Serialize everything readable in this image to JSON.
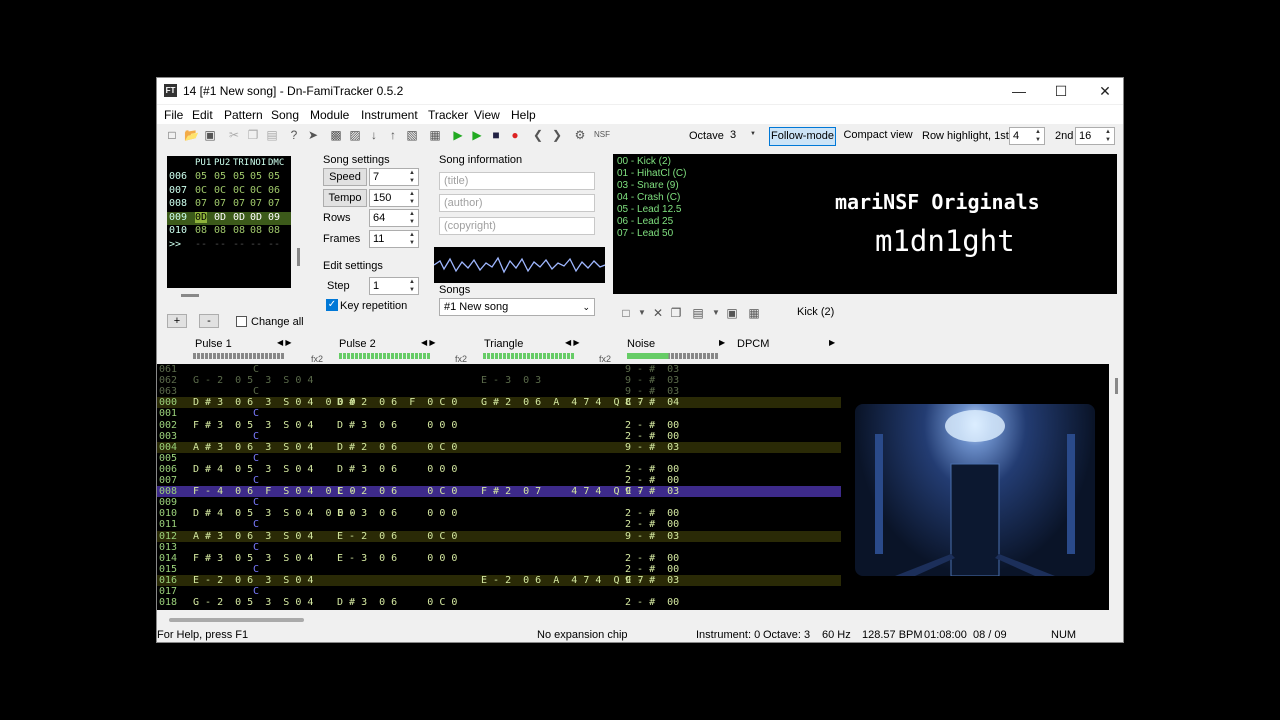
{
  "window": {
    "title": "14 [#1 New song] - Dn-FamiTracker 0.5.2"
  },
  "menu": [
    "File",
    "Edit",
    "Pattern",
    "Song",
    "Module",
    "Instrument",
    "Tracker",
    "View",
    "Help"
  ],
  "toolbar": {
    "octave_label": "Octave",
    "octave_value": "3",
    "follow_mode": "Follow-mode",
    "compact_view": "Compact view",
    "row_highlight_label": "Row highlight, 1st",
    "row_highlight_1st": "4",
    "second_label": "2nd",
    "row_highlight_2nd": "16",
    "nsf_icon": "NSF"
  },
  "frames": {
    "header": [
      "PU1",
      "PU2",
      "TRI",
      "NOI",
      "DMC"
    ],
    "rows": [
      {
        "num": "006",
        "vals": [
          "05",
          "05",
          "05",
          "05",
          "05"
        ]
      },
      {
        "num": "007",
        "vals": [
          "0C",
          "0C",
          "0C",
          "0C",
          "06"
        ]
      },
      {
        "num": "008",
        "vals": [
          "07",
          "07",
          "07",
          "07",
          "07"
        ]
      },
      {
        "num": "009",
        "vals": [
          "0D",
          "0D",
          "0D",
          "0D",
          "09"
        ]
      },
      {
        "num": "010",
        "vals": [
          "08",
          "08",
          "08",
          "08",
          "08"
        ]
      },
      {
        "num": ">>",
        "vals": [
          "--",
          "--",
          "--",
          "--",
          "--"
        ]
      }
    ],
    "add": "+",
    "remove": "-",
    "change_all": "Change all"
  },
  "song_settings": {
    "title": "Song settings",
    "speed_label": "Speed",
    "speed": "7",
    "tempo_label": "Tempo",
    "tempo": "150",
    "rows_label": "Rows",
    "rows": "64",
    "frames_label": "Frames",
    "frames": "11"
  },
  "edit_settings": {
    "title": "Edit settings",
    "step_label": "Step",
    "step": "1",
    "key_repetition": "Key repetition"
  },
  "song_info": {
    "title": "Song information",
    "title_ph": "(title)",
    "author_ph": "(author)",
    "copyright_ph": "(copyright)"
  },
  "songs": {
    "label": "Songs",
    "selected": "#1 New song"
  },
  "instruments": {
    "items": [
      "00 - Kick (2)",
      "01 - HihatCl (C)",
      "03 - Snare (9)",
      "04 - Crash (C)",
      "05 - Lead 12.5",
      "06 - Lead 25",
      "07 - Lead 50"
    ],
    "overlay_line1": "mariNSF Originals",
    "overlay_line2": "m1dn1ght",
    "selected_name": "Kick (2)"
  },
  "channels": {
    "pulse1": "Pulse 1",
    "pulse2": "Pulse 2",
    "triangle": "Triangle",
    "noise": "Noise",
    "dpcm": "DPCM",
    "fx": "fx2"
  },
  "pattern_rows": [
    {
      "n": "061",
      "p1": "",
      "c": "C",
      "p2": "",
      "tr": "",
      "no": "9 - #  03"
    },
    {
      "n": "062",
      "p1": "G - 2  0 5  3  S 0 4",
      "c": "",
      "p2": "",
      "tr": "E - 3  0 3",
      "no": "9 - #  03"
    },
    {
      "n": "063",
      "p1": "",
      "c": "C",
      "p2": "",
      "tr": "",
      "no": "9 - #  03"
    },
    {
      "n": "000",
      "p1": "D # 3  0 6  3  S 0 4  0 0 0",
      "c": "",
      "p2": "D # 2  0 6  F  0 C 0",
      "tr": "G # 2  0 6  A  4 7 4  Q C 7",
      "no": "8 - #  04"
    },
    {
      "n": "001",
      "p1": "",
      "c": "C",
      "p2": "",
      "tr": "",
      "no": ""
    },
    {
      "n": "002",
      "p1": "F # 3  0 5  3  S 0 4",
      "c": "",
      "p2": "D # 3  0 6     0 0 0",
      "tr": "",
      "no": "2 - #  00"
    },
    {
      "n": "003",
      "p1": "",
      "c": "C",
      "p2": "",
      "tr": "",
      "no": "2 - #  00"
    },
    {
      "n": "004",
      "p1": "A # 3  0 6  3  S 0 4",
      "c": "",
      "p2": "D # 2  0 6     0 C 0",
      "tr": "",
      "no": "9 - #  03"
    },
    {
      "n": "005",
      "p1": "",
      "c": "C",
      "p2": "",
      "tr": "",
      "no": ""
    },
    {
      "n": "006",
      "p1": "D # 4  0 5  3  S 0 4",
      "c": "",
      "p2": "D # 3  0 6     0 0 0",
      "tr": "",
      "no": "2 - #  00"
    },
    {
      "n": "007",
      "p1": "",
      "c": "C",
      "p2": "",
      "tr": "",
      "no": "2 - #  00"
    },
    {
      "n": "008",
      "p1": "F - 4  0 6  F  S 0 4  0 C 0",
      "c": "",
      "p2": "E - 2  0 6     0 C 0",
      "tr": "F # 2  0 7     4 7 4  Q C 7",
      "no": "9 - #  03"
    },
    {
      "n": "009",
      "p1": "",
      "c": "C",
      "p2": "",
      "tr": "",
      "no": ""
    },
    {
      "n": "010",
      "p1": "D # 4  0 5  3  S 0 4  0 0 0",
      "c": "",
      "p2": "E - 3  0 6     0 0 0",
      "tr": "",
      "no": "2 - #  00"
    },
    {
      "n": "011",
      "p1": "",
      "c": "C",
      "p2": "",
      "tr": "",
      "no": "2 - #  00"
    },
    {
      "n": "012",
      "p1": "A # 3  0 6  3  S 0 4",
      "c": "",
      "p2": "E - 2  0 6     0 C 0",
      "tr": "",
      "no": "9 - #  03"
    },
    {
      "n": "013",
      "p1": "",
      "c": "C",
      "p2": "",
      "tr": "",
      "no": ""
    },
    {
      "n": "014",
      "p1": "F # 3  0 5  3  S 0 4",
      "c": "",
      "p2": "E - 3  0 6     0 0 0",
      "tr": "",
      "no": "2 - #  00"
    },
    {
      "n": "015",
      "p1": "",
      "c": "C",
      "p2": "",
      "tr": "",
      "no": "2 - #  00"
    },
    {
      "n": "016",
      "p1": "E - 2  0 6  3  S 0 4",
      "c": "",
      "p2": "",
      "tr": "E - 2  0 6  A  4 7 4  Q C 7",
      "no": "9 - #  03"
    },
    {
      "n": "017",
      "p1": "",
      "c": "C",
      "p2": "",
      "tr": "",
      "no": ""
    },
    {
      "n": "018",
      "p1": "G - 2  0 5  3  S 0 4",
      "c": "",
      "p2": "D # 3  0 6     0 C 0",
      "tr": "",
      "no": "2 - #  00"
    }
  ],
  "status": {
    "help": "For Help, press F1",
    "chip": "No expansion chip",
    "instrument": "Instrument: 0",
    "octave": "Octave: 3",
    "hz": "60 Hz",
    "bpm": "128.57 BPM",
    "time": "01:08:00",
    "pos": "08 / 09",
    "num": "NUM"
  },
  "colors": {
    "accent": "#0078d7",
    "selected_row": "#3d2a8a",
    "highlight_row": "#2a2a06",
    "note": "#b7e37d",
    "inst": "#d8d8d8"
  }
}
